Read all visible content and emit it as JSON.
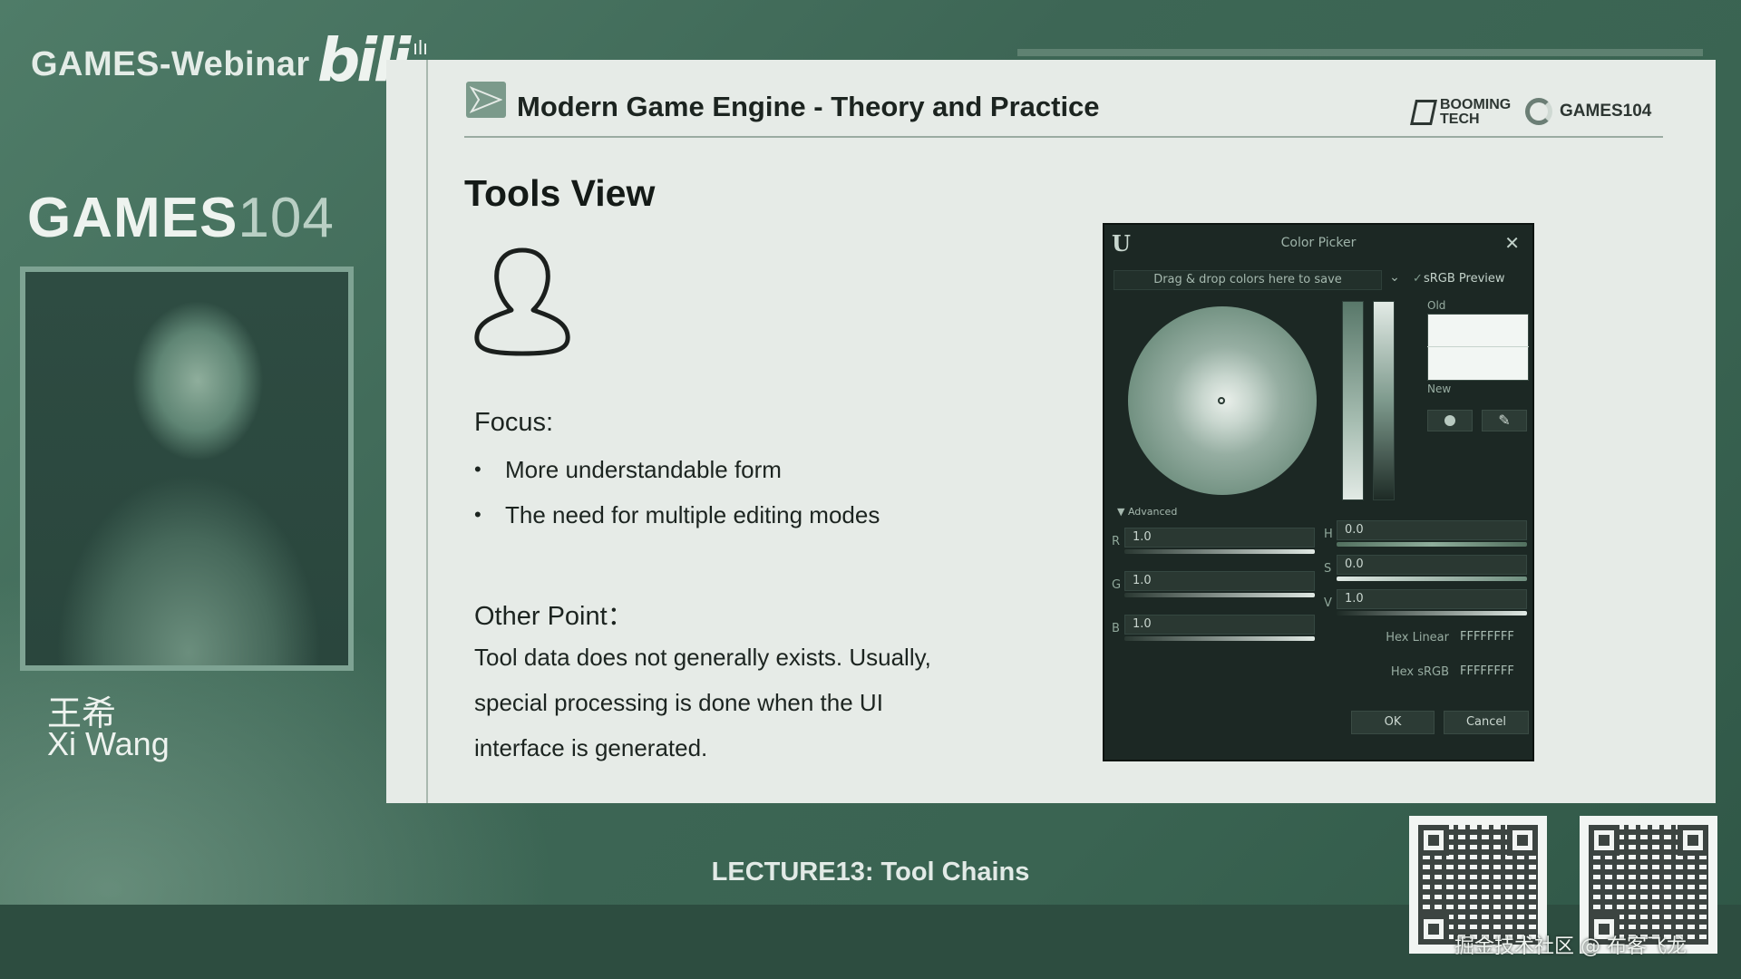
{
  "broadcast": {
    "title": "GAMES-Webinar",
    "platform_logo": "bili",
    "course_logo_main": "GAMES",
    "course_logo_num": "104"
  },
  "speaker": {
    "name_cn": "王希",
    "name_en": "Xi Wang"
  },
  "slide": {
    "course_title": "Modern Game Engine - Theory and Practice",
    "partner_logo_1": "BOOMING TECH",
    "partner_logo_2": "GAMES104",
    "heading": "Tools View",
    "focus_heading": "Focus:",
    "focus_items": [
      "More understandable form",
      "The need for multiple editing modes"
    ],
    "other_heading": "Other Point：",
    "other_lines": [
      "Tool data does not generally exists. Usually,",
      "special processing is done when the UI",
      "interface is generated."
    ]
  },
  "color_picker": {
    "window_title": "Color Picker",
    "themes_placeholder": "Drag & drop colors here to save",
    "srgb_label": "sRGB Preview",
    "old_label": "Old",
    "new_label": "New",
    "advanced_label": "Advanced",
    "r_label": "R",
    "r_value": "1.0",
    "g_label": "G",
    "g_value": "1.0",
    "b_label": "B",
    "b_value": "1.0",
    "h_label": "H",
    "h_value": "0.0",
    "s_label": "S",
    "s_value": "0.0",
    "v_label": "V",
    "v_value": "1.0",
    "hex_linear_label": "Hex Linear",
    "hex_linear_value": "FFFFFFFF",
    "hex_srgb_label": "Hex sRGB",
    "hex_srgb_value": "FFFFFFFF",
    "ok_label": "OK",
    "cancel_label": "Cancel"
  },
  "footer": {
    "lecture": "LECTURE13: Tool Chains",
    "watermark": "掘金技术社区 @ 布客飞龙"
  }
}
